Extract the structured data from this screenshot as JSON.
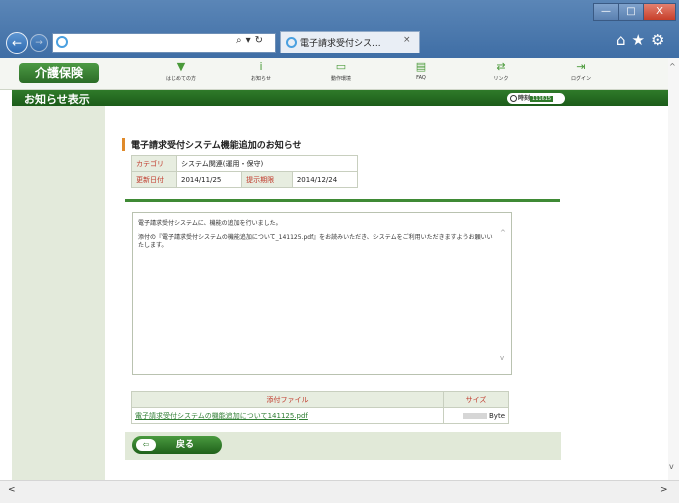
{
  "browser": {
    "back": "←",
    "forward": "→",
    "address_buttons": "⌕▾↻",
    "tab_title": "電子請求受付シス...",
    "tab_close": "×",
    "window_min": "—",
    "window_max": "□",
    "window_close": "X",
    "tools": "⌂★⚙"
  },
  "header": {
    "logo": "介護保険",
    "nav": [
      {
        "icon": "▼",
        "label": "はじめての方"
      },
      {
        "icon": "i",
        "label": "お知らせ"
      },
      {
        "icon": "▭",
        "label": "動作環境"
      },
      {
        "icon": "▤",
        "label": "FAQ"
      },
      {
        "icon": "⇄",
        "label": "リンク"
      },
      {
        "icon": "⇥",
        "label": "ログイン"
      }
    ]
  },
  "titlebar": {
    "title": "お知らせ表示",
    "clock_label": "時刻",
    "clock_value": "111615"
  },
  "notice": {
    "title": "電子請求受付システム機能追加のお知らせ",
    "category_label": "カテゴリ",
    "category_value": "システム関連(運用・保守)",
    "updated_label": "更新日付",
    "updated_value": "2014/11/25",
    "period_label": "提示期限",
    "period_value": "2014/12/24",
    "message_line1": "電子請求受付システムに、機能の追加を行いました。",
    "message_line2": "添付の『電子請求受付システムの機能追加について_141125.pdf』をお読みいただき、システムをご利用いただきますようお願いいたします。"
  },
  "attachments": {
    "col_file": "添付ファイル",
    "col_size": "サイズ",
    "rows": [
      {
        "file": "電子請求受付システムの機能追加について141125.pdf",
        "size": "Byte"
      }
    ]
  },
  "back_button": {
    "icon": "⇦",
    "label": "戻る"
  },
  "scroll": {
    "up": "^",
    "down": "v",
    "left": "<",
    "right": ">"
  }
}
